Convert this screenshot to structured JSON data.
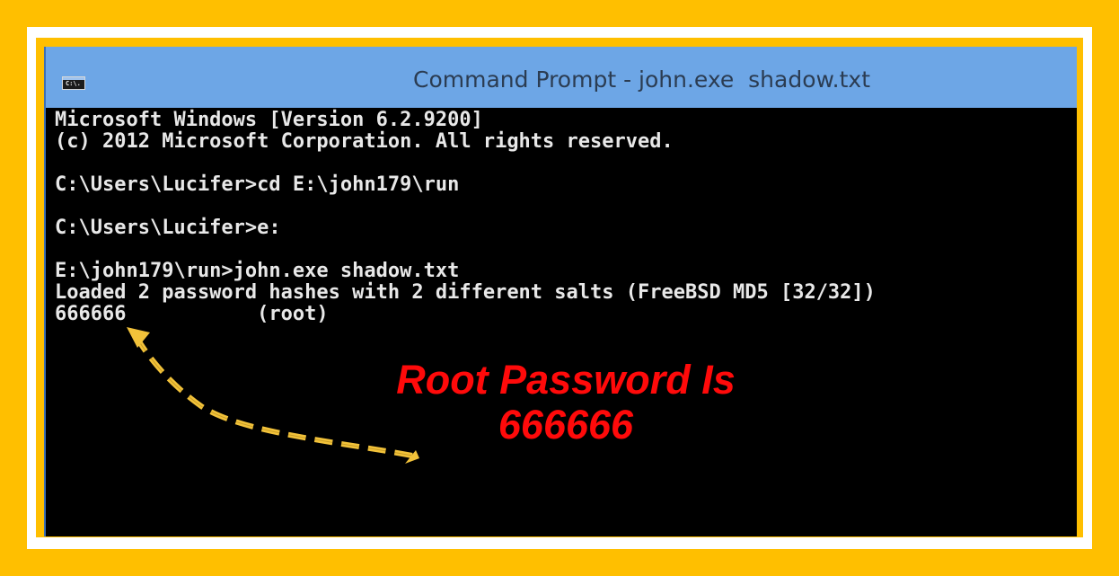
{
  "window": {
    "title": "Command Prompt - john.exe  shadow.txt",
    "icon": "cmd-icon",
    "icon_label": "C:\\."
  },
  "console": {
    "lines": [
      "Microsoft Windows [Version 6.2.9200]",
      "(c) 2012 Microsoft Corporation. All rights reserved.",
      "",
      "C:\\Users\\Lucifer>cd E:\\john179\\run",
      "",
      "C:\\Users\\Lucifer>e:",
      "",
      "E:\\john179\\run>john.exe shadow.txt",
      "Loaded 2 password hashes with 2 different salts (FreeBSD MD5 [32/32])",
      "666666           (root)"
    ]
  },
  "annotation": {
    "line1": "Root Password Is",
    "line2": "666666"
  },
  "colors": {
    "frame": "#FFBF00",
    "titlebar": "#6DA6E6",
    "console_bg": "#000000",
    "console_text": "#E8E8E8",
    "annotation_text": "#FF0A0A",
    "arrow": "#F2C23A"
  }
}
